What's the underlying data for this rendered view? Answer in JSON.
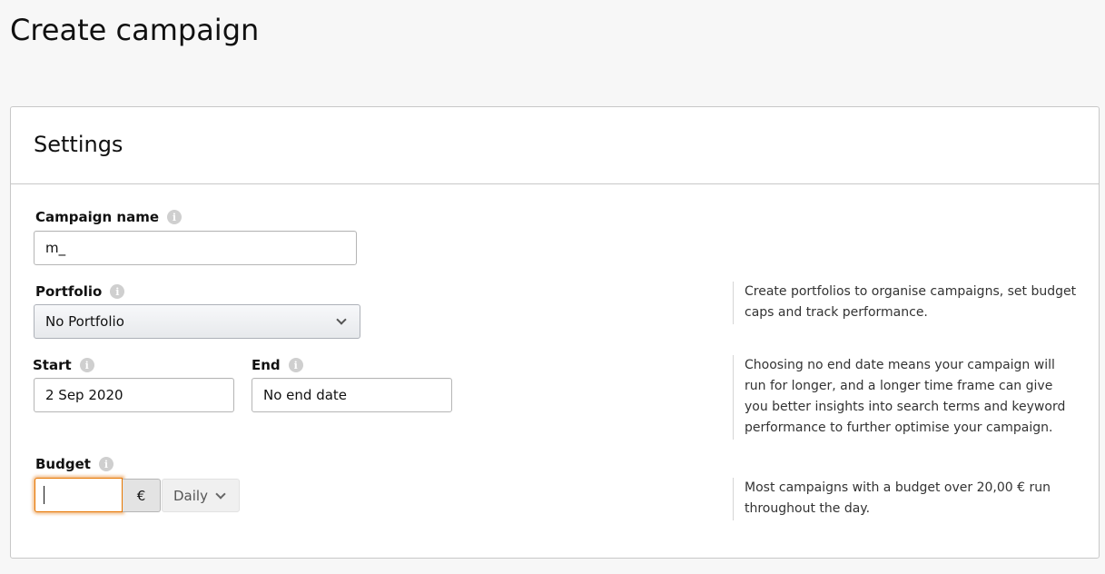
{
  "page": {
    "title": "Create campaign"
  },
  "settings": {
    "title": "Settings",
    "campaign_name": {
      "label": "Campaign name",
      "value": "m_"
    },
    "portfolio": {
      "label": "Portfolio",
      "selected": "No Portfolio",
      "hint": "Create portfolios to organise campaigns, set budget caps and track performance."
    },
    "start": {
      "label": "Start",
      "value": "2 Sep 2020"
    },
    "end": {
      "label": "End",
      "value": "No end date"
    },
    "dates_hint": "Choosing no end date means your campaign will run for longer, and a longer time frame can give you better insights into search terms and keyword performance to further optimise your campaign.",
    "budget": {
      "label": "Budget",
      "value": "",
      "currency": "€",
      "frequency": "Daily",
      "hint": "Most campaigns with a budget over 20,00 € run throughout the day."
    }
  },
  "icons": {
    "info": "info-icon",
    "dropdown": "chevron-down-icon"
  },
  "colors": {
    "focus": "#e77600",
    "background": "#f7f7f7",
    "border": "#c8c8c8"
  }
}
